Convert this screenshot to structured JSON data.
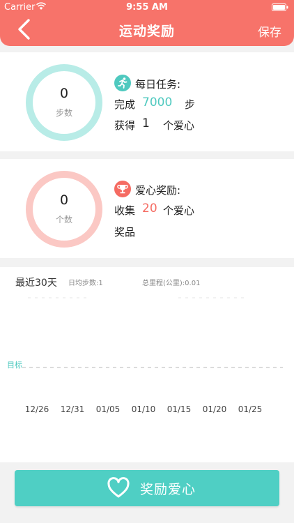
{
  "status": {
    "carrier": "Carrier",
    "time": "9:55 AM"
  },
  "nav": {
    "title": "运动奖励",
    "save_label": "保存"
  },
  "steps_card": {
    "count": "0",
    "unit": "步数",
    "task_title": "每日任务:",
    "complete_prefix": "完成",
    "step_goal": "7000",
    "step_unit": "步",
    "earn_prefix": "获得",
    "earn_value": "1",
    "earn_unit": "个爱心",
    "ring_color": "#b8ece7",
    "badge_color": "#4fc9bf",
    "badge_icon": "running-person-icon"
  },
  "love_card": {
    "count": "0",
    "unit": "个数",
    "title": "爱心奖励:",
    "collect_prefix": "收集",
    "collect_value": "20",
    "collect_unit": "个爱心",
    "prize_label": "奖品",
    "ring_color": "#fbc8c4",
    "badge_color": "#f56b62",
    "badge_icon": "trophy-icon"
  },
  "chart_data": {
    "type": "line",
    "title": "最近30天",
    "avg_label": "日均步数:1",
    "distance_label": "总里程(公里):0.01",
    "goal_label": "目标",
    "x_ticks": [
      "12/26",
      "12/31",
      "01/05",
      "01/10",
      "01/15",
      "01/20",
      "01/25"
    ],
    "series": [],
    "grid": false
  },
  "footer": {
    "button_label": "奖励爱心",
    "button_color": "#4fcfc4",
    "icon": "heart-outline-icon"
  }
}
